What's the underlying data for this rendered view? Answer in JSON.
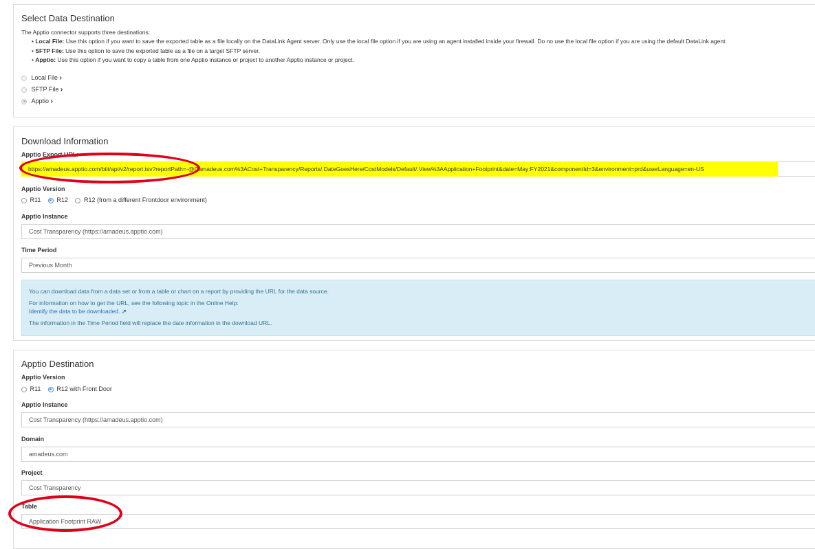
{
  "select_destination": {
    "title": "Select Data Destination",
    "intro": "The Apptio connector supports three destinations:",
    "bullets": [
      {
        "term": "Local File:",
        "text": " Use this option if you want to save the exported table as a file locally on the DataLink Agent server. Only use the local file option if you are using an agent installed inside your firewall. Do no use the local file option if you are using the default DataLink agent."
      },
      {
        "term": "SFTP File:",
        "text": " Use this option to save the exported table as a file on a target SFTP server."
      },
      {
        "term": "Apptio:",
        "text": " Use this option if you want to copy a table from one Apptio instance or project to another Apptio instance or project."
      }
    ],
    "options": [
      {
        "label": "Local File",
        "checked": false
      },
      {
        "label": "SFTP File",
        "checked": false
      },
      {
        "label": "Apptio",
        "checked": true
      }
    ]
  },
  "download_info": {
    "title": "Download Information",
    "export_url_label": "Apptio Export URL:",
    "export_url_value": "https://amadeus.apptio.com/biit/api/v2/report.tsv?reportPath=-@Camadeus.com%3ACost+Transparency/Reports/.DateGoesHere/CostModels/Default/.View%3AApplication+Footprint&date=May:FY2021&componentId=3&environment=prd&userLanguage=en-US",
    "version_label": "Apptio Version",
    "version_options": [
      {
        "label": "R11",
        "checked": false
      },
      {
        "label": "R12",
        "checked": true
      },
      {
        "label": "R12 (from a different Frontdoor environment)",
        "checked": false
      }
    ],
    "instance_label": "Apptio Instance",
    "instance_value": "Cost Transparency (https://amadeus.apptio.com)",
    "time_period_label": "Time Period",
    "time_period_value": "Previous Month",
    "info": {
      "line1": "You can download data from a data set or from a table or chart on a report by providing the URL for the data source.",
      "line2": "For information on how to get the URL, see the following topic in the Online Help:",
      "link": "Identify the data to be downloaded.",
      "line4": "The information in the Time Period field will replace the date information in the download URL."
    }
  },
  "apptio_destination": {
    "title": "Apptio Destination",
    "version_label": "Apptio Version",
    "version_options": [
      {
        "label": "R11",
        "checked": false
      },
      {
        "label": "R12 with Front Door",
        "checked": true
      }
    ],
    "instance_label": "Apptio Instance",
    "instance_value": "Cost Transparency (https://amadeus.apptio.com)",
    "domain_label": "Domain",
    "domain_value": "amadeus.com",
    "project_label": "Project",
    "project_value": "Cost Transparency",
    "table_label": "Table",
    "table_value": "Application Footprint RAW"
  },
  "colors": {
    "highlight": "#ffff00",
    "annotation_oval": "#e0001a",
    "info_bg": "#d9edf7",
    "info_text": "#31708f"
  }
}
